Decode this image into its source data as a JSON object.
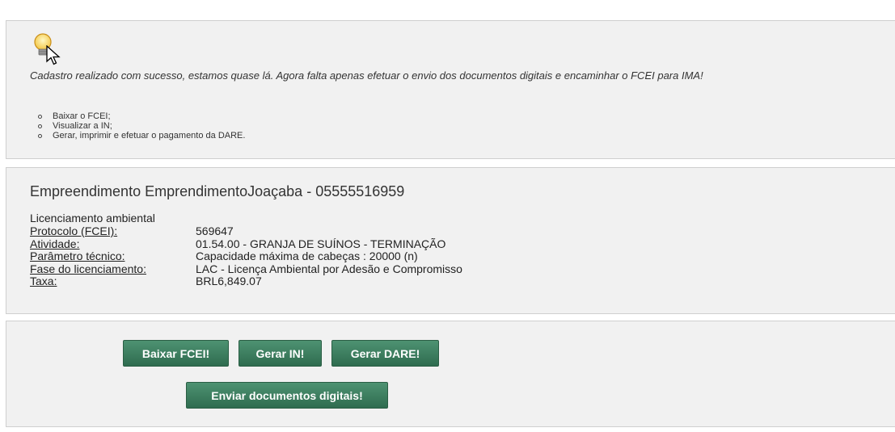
{
  "notice": {
    "message": "Cadastro realizado com sucesso, estamos quase lá. Agora falta apenas efetuar o envio dos documentos digitais e encaminhar o FCEI para IMA!",
    "steps": [
      "Baixar o FCEI;",
      "Visualizar a IN;",
      "Gerar, imprimir e efetuar o pagamento da DARE."
    ]
  },
  "enterprise": {
    "title": "Empreendimento EmprendimentoJoaçaba - 05555516959",
    "section": "Licenciamento ambiental",
    "fields": [
      {
        "label": "Protocolo (FCEI):",
        "value": "569647"
      },
      {
        "label": "Atividade:",
        "value": "01.54.00 - GRANJA DE SUÍNOS - TERMINAÇÃO"
      },
      {
        "label": "Parâmetro técnico:",
        "value": "Capacidade máxima de cabeças : 20000 (n)"
      },
      {
        "label": "Fase do licenciamento:",
        "value": "LAC - Licença Ambiental por Adesão e Compromisso"
      },
      {
        "label": "Taxa:",
        "value": "BRL6,849.07"
      }
    ]
  },
  "actions": {
    "download_fcei": "Baixar FCEI!",
    "generate_in": "Gerar IN!",
    "generate_dare": "Gerar DARE!",
    "send_documents": "Enviar documentos digitais!"
  },
  "colors": {
    "button_green": "#3a7c5c",
    "panel_bg": "#f1f1f1"
  }
}
